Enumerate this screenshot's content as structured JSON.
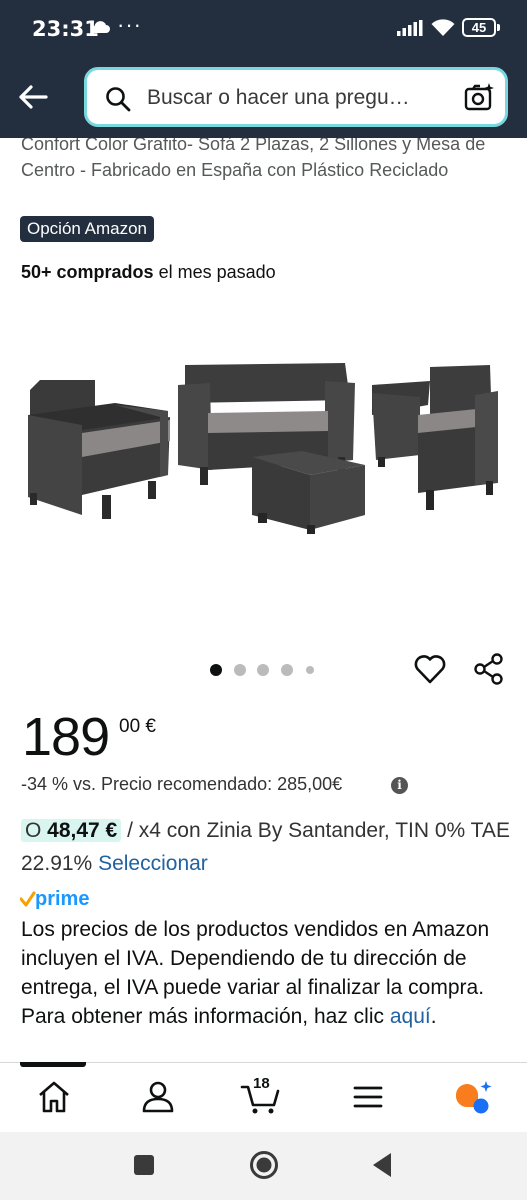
{
  "status_bar": {
    "time": "23:31",
    "more": "···",
    "battery": "45"
  },
  "header": {
    "search_placeholder": "Buscar o hacer una pregu…"
  },
  "product": {
    "title": "Confort Color Grafito- Sofá 2 Plazas, 2 Sillones y Mesa de Centro - Fabricado en España con Plástico Reciclado",
    "badge": "Opción Amazon",
    "bought_bold": "50+ comprados",
    "bought_rest": " el mes pasado",
    "image_dots": 5,
    "image_active": 1
  },
  "price": {
    "whole": "189",
    "cents": "00 €",
    "discount": "-34 % vs. Precio recomendado: 285,00€",
    "info": "i"
  },
  "financing": {
    "prefix": "O ",
    "amount": "48,47 €",
    "rest": " / x4 con Zinia By Santander, TIN 0% TAE 22.91% ",
    "link": "Seleccionar"
  },
  "prime": {
    "label": "prime"
  },
  "iva": {
    "text": "Los precios de los productos vendidos en Amazon incluyen el IVA. Dependiendo de tu dirección de entrega, el IVA puede variar al finalizar la compra. Para obtener más información, haz clic ",
    "link": "aquí",
    "end": "."
  },
  "bottom_nav": {
    "cart_count": "18",
    "items": [
      "home-icon",
      "account-icon",
      "cart-icon",
      "menu-icon",
      "rufus-icon"
    ]
  },
  "colors": {
    "header_bg": "#232f3e",
    "link": "#2162a1",
    "prime_blue": "#1a98ff",
    "prime_check": "#f7a000",
    "financing_bg": "#d8f5ef"
  }
}
